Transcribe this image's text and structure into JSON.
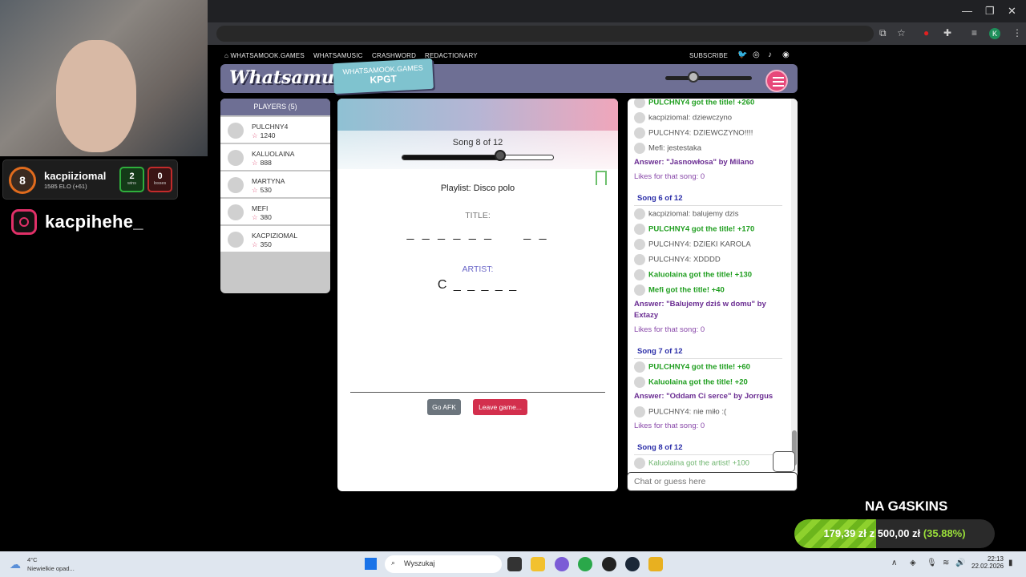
{
  "nav": {
    "home": "WHATSAMOOK.GAMES",
    "items": [
      "WHATSAMUSIC",
      "CRASHWORD",
      "REDACTIONARY"
    ],
    "subscribe": "SUBSCRIBE"
  },
  "header": {
    "logo": "Whatsamusic",
    "badge_line1": "WHATSAMOOK.GAMES",
    "badge_line2": "KPGT",
    "volume": 0.3
  },
  "players": {
    "title": "PLAYERS (5)",
    "list": [
      {
        "name": "PULCHNY4",
        "score": "1240"
      },
      {
        "name": "KALUOLAINA",
        "score": "888"
      },
      {
        "name": "MARTYNA",
        "score": "530"
      },
      {
        "name": "MEFI",
        "score": "380"
      },
      {
        "name": "KACPIZIOMAL",
        "score": "350"
      }
    ]
  },
  "game": {
    "song": "Song 8 of 12",
    "progress": 0.64,
    "playlist": "Playlist: Disco polo",
    "title_label": "TITLE:",
    "title_hint": "_ _ _ _ _ _     _ _",
    "artist_label": "ARTIST:",
    "artist_hint": "C _ _ _ _ _",
    "afk": "Go AFK",
    "leave": "Leave game..."
  },
  "chat": {
    "messages": [
      {
        "t": "PULCHNY4 got the title! +260",
        "k": "g"
      },
      {
        "t": "kacpiziomal: dziewczyno",
        "k": "u"
      },
      {
        "t": "PULCHNY4: DZIEWCZYNO!!!!",
        "k": "u"
      },
      {
        "t": "Mefi: jestestaka",
        "k": "u"
      },
      {
        "t": "Answer: \"Jasnowłosa\" by Milano",
        "k": "a"
      },
      {
        "t": "Likes for that song: 0",
        "k": "l"
      },
      {
        "t": "Song 6 of 12",
        "k": "h"
      },
      {
        "t": "kacpiziomal: balujemy dzis",
        "k": "u"
      },
      {
        "t": "PULCHNY4 got the title! +170",
        "k": "g"
      },
      {
        "t": "PULCHNY4: DZIEKI KAROLA",
        "k": "u"
      },
      {
        "t": "PULCHNY4: XDDDD",
        "k": "u"
      },
      {
        "t": "Kaluolaina got the title! +130",
        "k": "g"
      },
      {
        "t": "Mefi got the title! +40",
        "k": "g"
      },
      {
        "t": "Answer: \"Balujemy dziś w domu\" by",
        "k": "a"
      },
      {
        "t": "Extazy",
        "k": "a"
      },
      {
        "t": "Likes for that song: 0",
        "k": "l"
      },
      {
        "t": "Song 7 of 12",
        "k": "h"
      },
      {
        "t": "PULCHNY4 got the title! +60",
        "k": "g"
      },
      {
        "t": "Kaluolaina got the title! +20",
        "k": "g"
      },
      {
        "t": "Answer: \"Oddam Ci serce\" by Jorrgus",
        "k": "a"
      },
      {
        "t": "PULCHNY4: nie miło :(",
        "k": "u"
      },
      {
        "t": "Likes for that song: 0",
        "k": "l"
      },
      {
        "t": "Song 8 of 12",
        "k": "h"
      },
      {
        "t": "Kaluolaina got the artist! +100",
        "k": "g2"
      }
    ],
    "placeholder": "Chat or guess here"
  },
  "overlay": {
    "elo_level": "8",
    "name": "kacpiiziomal",
    "elo": "1585 ELO (+61)",
    "wins": "2",
    "wins_label": "wins",
    "losses": "0",
    "losses_label": "losses",
    "instagram": "kacpihehe_",
    "promo": "NA G4SKINS",
    "promo_amount": "179,39 zł",
    "promo_z": "z",
    "promo_target": "500,00 zł",
    "promo_pct": "(35.88%)",
    "promo_progress": 0.3588
  },
  "taskbar": {
    "temp": "4°C",
    "weather": "Niewielkie opad...",
    "search": "Wyszukaj",
    "time": "22:13",
    "date": "22.02.2026"
  },
  "colors": {
    "accent": "#6e6f94",
    "green": "#1f9e1f",
    "leave": "#d32f4d"
  }
}
